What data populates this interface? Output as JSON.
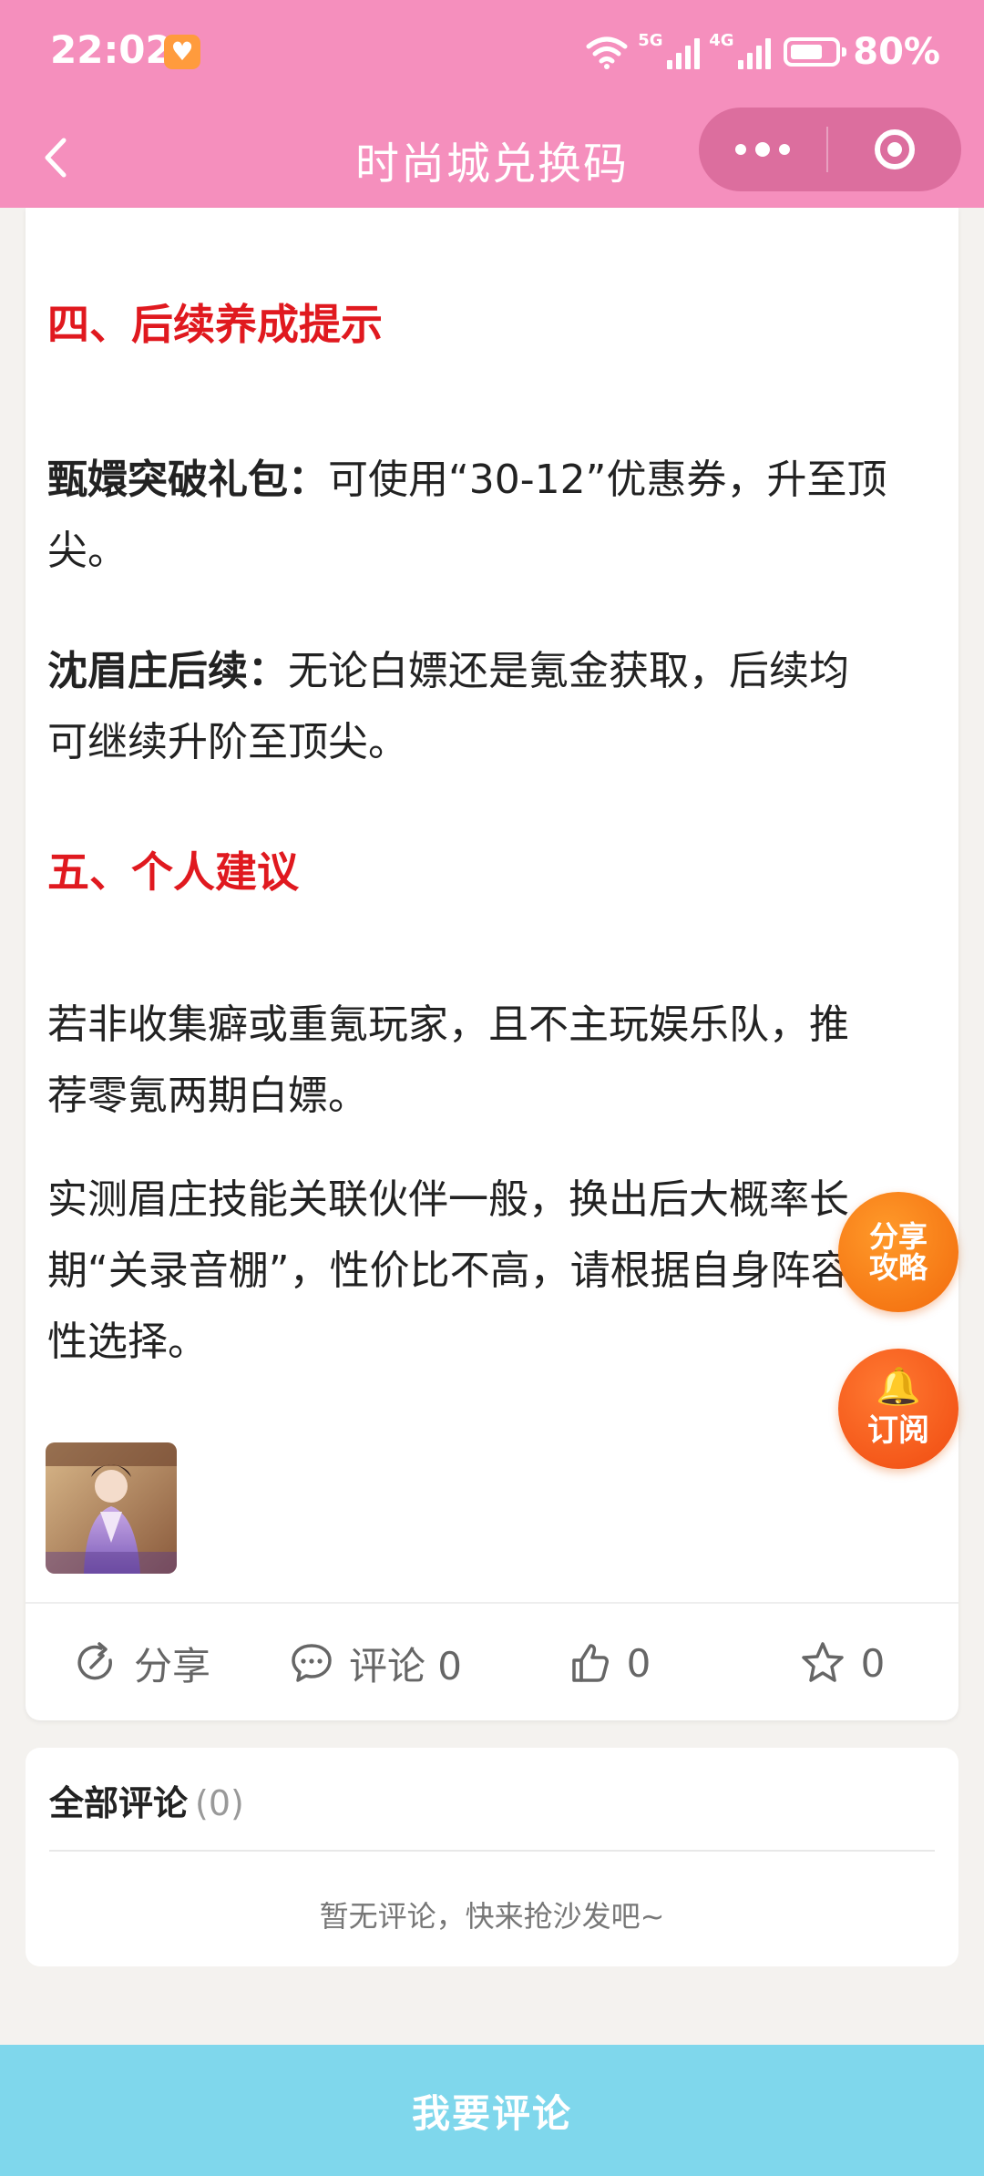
{
  "status": {
    "time": "22:02",
    "battery": "80%",
    "net1": "5G",
    "net2": "4G"
  },
  "nav": {
    "title": "时尚城兑换码"
  },
  "article": {
    "section4": "四、后续养成提示",
    "p1_bold": "甄嬛突破礼包：",
    "p1_line1": "可使用“30-12”优惠券，升至顶",
    "p1_line2": "尖。",
    "p2_bold": "沈眉庄后续：",
    "p2_line1": "无论白嫖还是氪金获取，后续均",
    "p2_line2": "可继续升阶至顶尖。",
    "section5": "五、个人建议",
    "p3_line1": "若非收集癖或重氪玩家，且不主玩娱乐队，推",
    "p3_line2": "荐零氪两期白嫖。",
    "p4_line1": "实测眉庄技能关联伙伴一般，换出后大概率长",
    "p4_line2": "期“关录音棚”，性价比不高，请根据自身阵容理",
    "p4_line3": "性选择。"
  },
  "actions": {
    "share": "分享",
    "comment": "评论 0",
    "like": "0",
    "fav": "0"
  },
  "fabs": {
    "share_line1": "分享",
    "share_line2": "攻略",
    "subscribe": "订阅"
  },
  "comments": {
    "title": "全部评论",
    "count": "(0)",
    "empty": "暂无评论，快来抢沙发吧~"
  },
  "bottom": {
    "label": "我要评论"
  },
  "colors": {
    "header": "#f58fbd",
    "heading_red": "#e0191f",
    "fab_orange": "#f5780f",
    "bottom_btn": "#7fd7ec"
  }
}
